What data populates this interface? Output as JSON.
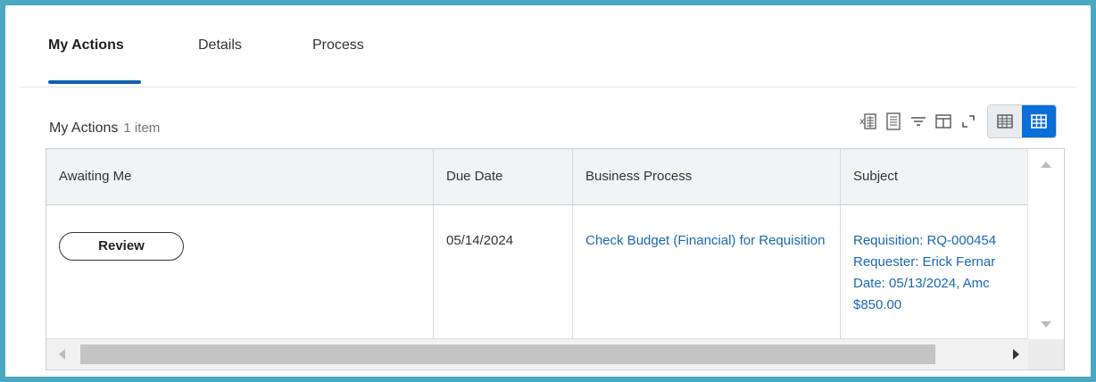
{
  "tabs": [
    {
      "label": "My Actions"
    },
    {
      "label": "Details"
    },
    {
      "label": "Process"
    }
  ],
  "section": {
    "title": "My Actions",
    "count": "1 item"
  },
  "toolbar": {
    "icons": [
      "export-excel-icon",
      "print-icon",
      "filter-icon",
      "columns-icon",
      "fullscreen-icon",
      "table-view-icon",
      "grid-view-icon"
    ]
  },
  "table": {
    "columns": [
      "Awaiting Me",
      "Due Date",
      "Business Process",
      "Subject"
    ],
    "rows": [
      {
        "action": "Review",
        "due_date": "05/14/2024",
        "business_process": "Check Budget (Financial) for Requisition",
        "subject_lines": [
          "Requisition: RQ-000454",
          "Requester: Erick Fernar",
          "Date: 05/13/2024, Amc",
          "$850.00"
        ]
      }
    ]
  },
  "colors": {
    "frame": "#4aa8c0",
    "accent": "#0a6fd6",
    "link": "#1a66b8",
    "tab_underline": "#1061b0"
  }
}
